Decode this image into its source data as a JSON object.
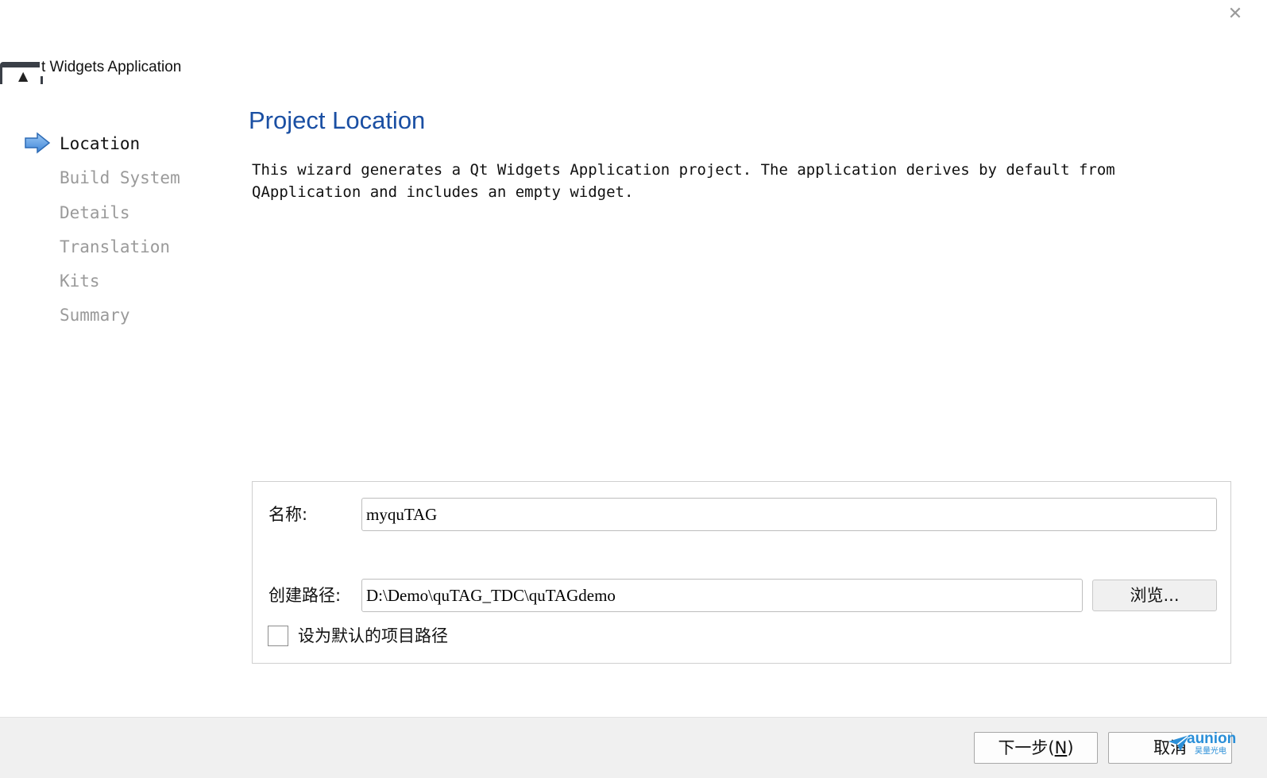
{
  "window": {
    "close_symbol": "✕",
    "app_title": "t Widgets Application"
  },
  "sidebar": {
    "steps": [
      {
        "label": "Location",
        "active": true
      },
      {
        "label": "Build System",
        "active": false
      },
      {
        "label": "Details",
        "active": false
      },
      {
        "label": "Translation",
        "active": false
      },
      {
        "label": "Kits",
        "active": false
      },
      {
        "label": "Summary",
        "active": false
      }
    ],
    "current_step_icon": "arrow-right-icon"
  },
  "main": {
    "title": "Project Location",
    "description_line1": "This wizard generates a Qt Widgets Application project. The application derives by default from",
    "description_line2": "QApplication and includes an empty widget."
  },
  "form": {
    "name_label": "名称:",
    "name_value": "myquTAG",
    "path_label": "创建路径:",
    "path_value": "D:\\Demo\\quTAG_TDC\\quTAGdemo",
    "browse_label": "浏览...",
    "default_checkbox_label": "设为默认的项目路径",
    "default_checked": false
  },
  "footer": {
    "next_label_prefix": "下一步(",
    "next_mnemonic": "N",
    "next_label_suffix": ")",
    "cancel_label": "取消"
  },
  "watermark": {
    "text": "aunion",
    "sub": "昊量光电"
  },
  "colors": {
    "title_blue": "#1a4fa3",
    "inactive_step": "#9a9a9a",
    "footer_bg": "#f0f0f0",
    "watermark_blue": "#2a8fd8"
  }
}
